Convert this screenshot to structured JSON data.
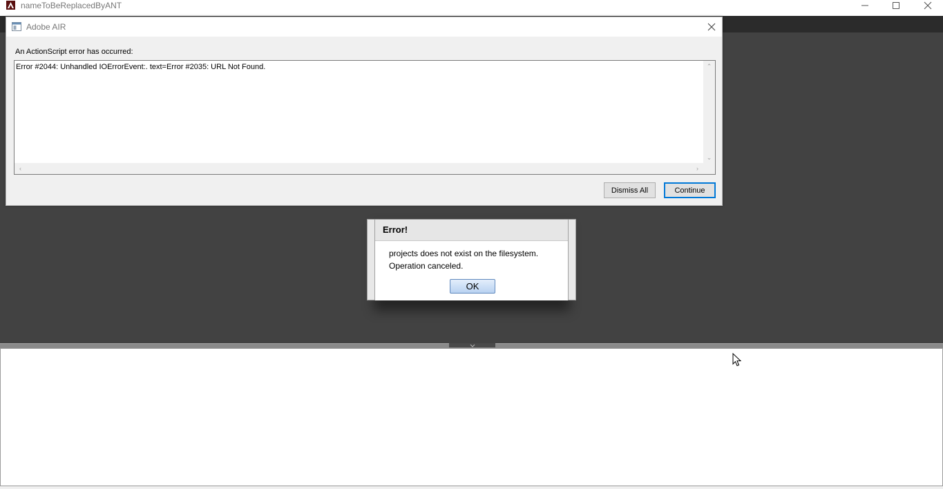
{
  "window": {
    "title": "nameToBeReplacedByANT",
    "controls": {
      "minimize": "—",
      "maximize": "☐",
      "close": "✕"
    }
  },
  "air_dialog": {
    "title": "Adobe AIR",
    "close": "✕",
    "label": "An ActionScript error has occurred:",
    "error_text": "Error #2044: Unhandled IOErrorEvent:. text=Error #2035: URL Not Found.",
    "buttons": {
      "dismiss_all": "Dismiss All",
      "continue": "Continue"
    },
    "scroll_arrows": {
      "up": "⌃",
      "down": "⌄",
      "left": "‹",
      "right": "›"
    }
  },
  "error_dialog": {
    "title": "Error!",
    "message_line1": "projects does not exist on the filesystem.",
    "message_line2": "Operation canceled.",
    "ok": "OK"
  },
  "colors": {
    "workspace": "#424242",
    "menubar": "#2b2b2b",
    "ok_button": "#b9d2f1",
    "focus_border": "#0078d7"
  },
  "icons": {
    "app": "adobe-logo-icon",
    "air": "window-app-icon",
    "cursor": "mouse-pointer-icon"
  }
}
